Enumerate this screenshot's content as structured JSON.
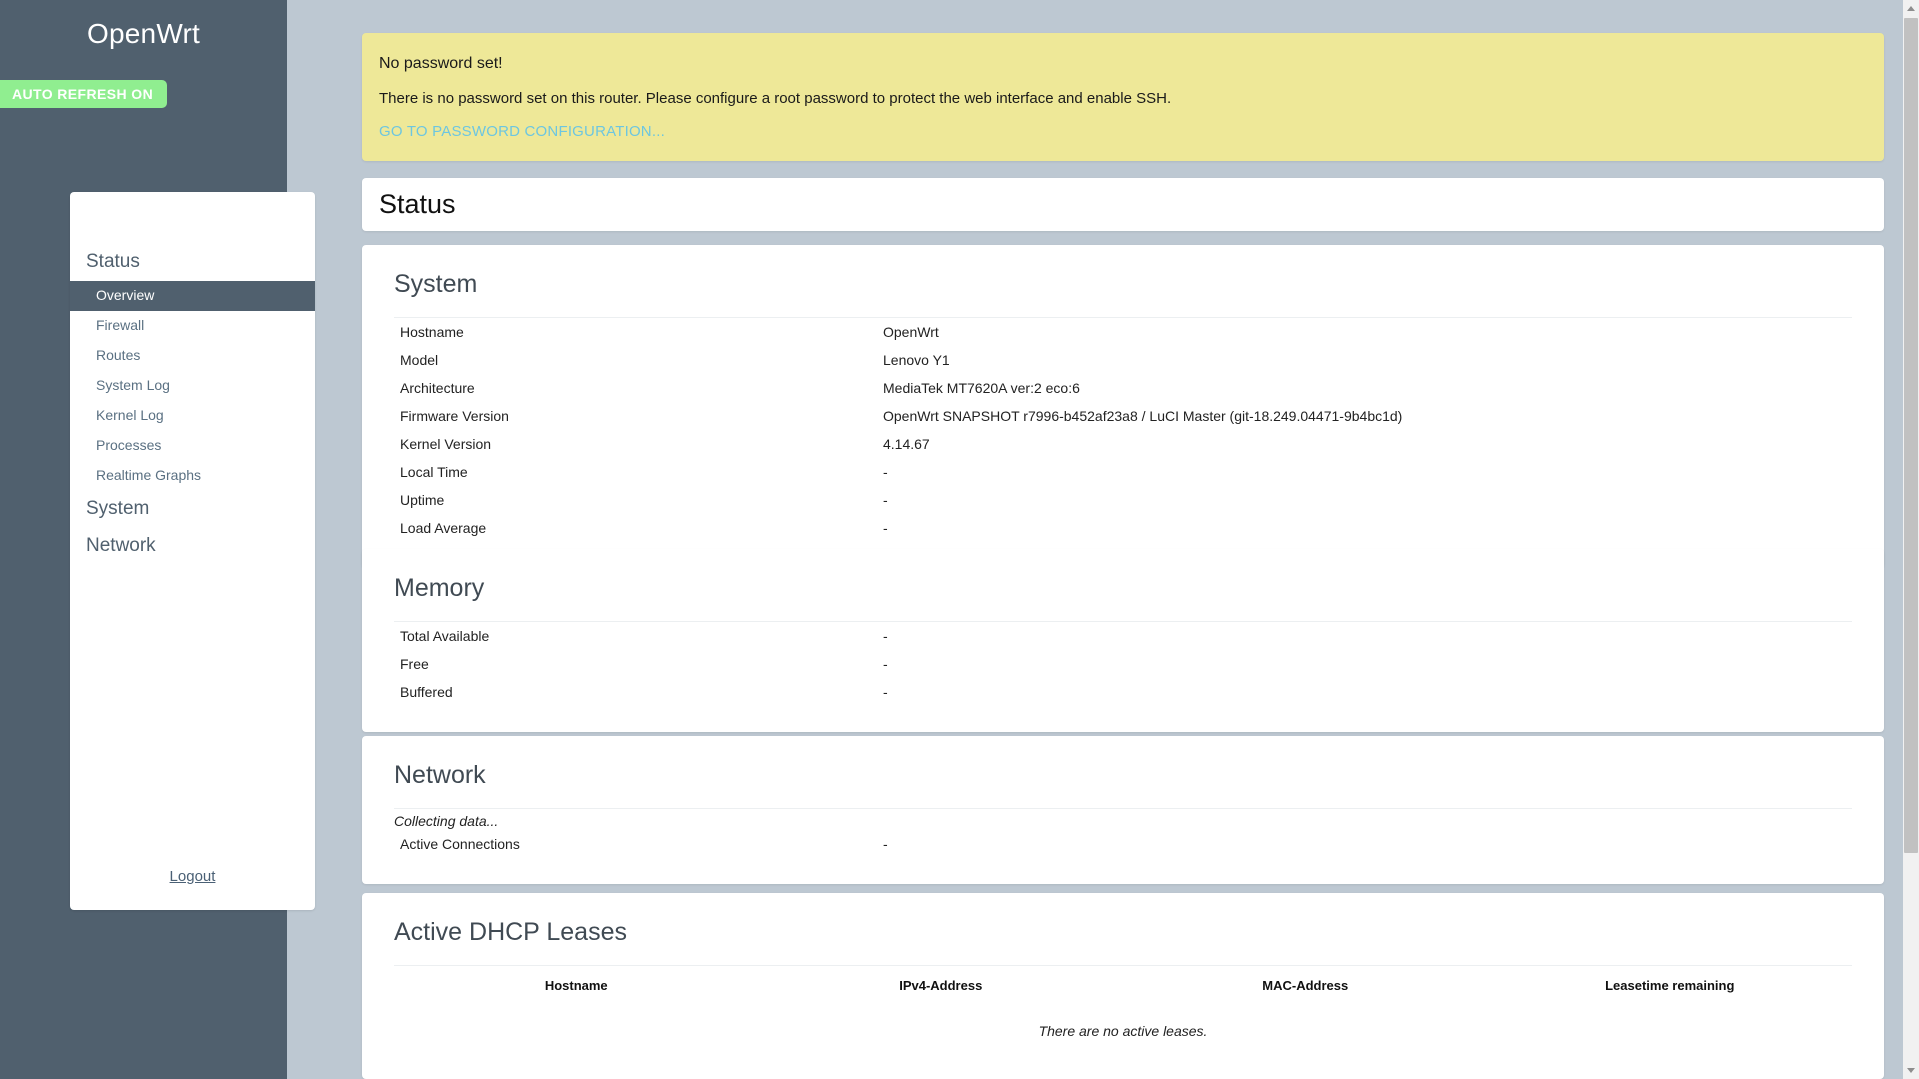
{
  "sidebar": {
    "brand": "OpenWrt",
    "auto_refresh_label": "AUTO REFRESH ON",
    "logout_label": "Logout",
    "menu": [
      {
        "label": "Status",
        "type": "main"
      },
      {
        "label": "Overview",
        "type": "sub",
        "active": true
      },
      {
        "label": "Firewall",
        "type": "sub",
        "active": false
      },
      {
        "label": "Routes",
        "type": "sub",
        "active": false
      },
      {
        "label": "System Log",
        "type": "sub",
        "active": false
      },
      {
        "label": "Kernel Log",
        "type": "sub",
        "active": false
      },
      {
        "label": "Processes",
        "type": "sub",
        "active": false
      },
      {
        "label": "Realtime Graphs",
        "type": "sub",
        "active": false
      },
      {
        "label": "System",
        "type": "main"
      },
      {
        "label": "Network",
        "type": "main"
      }
    ]
  },
  "warning": {
    "title": "No password set!",
    "text": "There is no password set on this router. Please configure a root password to protect the web interface and enable SSH.",
    "link_label": "GO TO PASSWORD CONFIGURATION...",
    "background_color": "#eee898",
    "link_color": "#6dc6e0"
  },
  "page": {
    "title": "Status"
  },
  "system": {
    "title": "System",
    "rows": [
      {
        "key": "Hostname",
        "value": "OpenWrt"
      },
      {
        "key": "Model",
        "value": "Lenovo Y1"
      },
      {
        "key": "Architecture",
        "value": "MediaTek MT7620A ver:2 eco:6"
      },
      {
        "key": "Firmware Version",
        "value": "OpenWrt SNAPSHOT r7996-b452af23a8 / LuCI Master (git-18.249.04471-9b4bc1d)"
      },
      {
        "key": "Kernel Version",
        "value": "4.14.67"
      },
      {
        "key": "Local Time",
        "value": "-"
      },
      {
        "key": "Uptime",
        "value": "-"
      },
      {
        "key": "Load Average",
        "value": "-"
      }
    ]
  },
  "memory": {
    "title": "Memory",
    "rows": [
      {
        "key": "Total Available",
        "value": "-"
      },
      {
        "key": "Free",
        "value": "-"
      },
      {
        "key": "Buffered",
        "value": "-"
      }
    ]
  },
  "network": {
    "title": "Network",
    "collecting_label": "Collecting data...",
    "rows": [
      {
        "key": "Active Connections",
        "value": "-"
      }
    ]
  },
  "dhcp": {
    "title": "Active DHCP Leases",
    "columns": [
      "Hostname",
      "IPv4-Address",
      "MAC-Address",
      "Leasetime remaining"
    ],
    "rows": [],
    "empty_message": "There are no active leases."
  },
  "theme": {
    "sidebar_bg": "#50606e",
    "page_bg": "#bdc8d2",
    "panel_bg": "#ffffff",
    "badge_green": "#90ee90"
  }
}
